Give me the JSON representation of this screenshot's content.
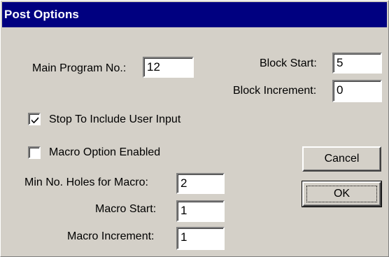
{
  "window": {
    "title": "Post Options"
  },
  "fields": {
    "main_program_label": "Main Program No.:",
    "main_program_value": "12",
    "block_start_label": "Block Start:",
    "block_start_value": "5",
    "block_increment_label": "Block Increment:",
    "block_increment_value": "0",
    "min_holes_label": "Min No. Holes for Macro:",
    "min_holes_value": "2",
    "macro_start_label": "Macro Start:",
    "macro_start_value": "1",
    "macro_increment_label": "Macro Increment:",
    "macro_increment_value": "1"
  },
  "checkboxes": {
    "stop_user_input_label": "Stop To Include User Input",
    "stop_user_input_checked": true,
    "macro_option_label": "Macro Option Enabled",
    "macro_option_checked": false
  },
  "buttons": {
    "cancel_label": "Cancel",
    "ok_label": "OK"
  }
}
